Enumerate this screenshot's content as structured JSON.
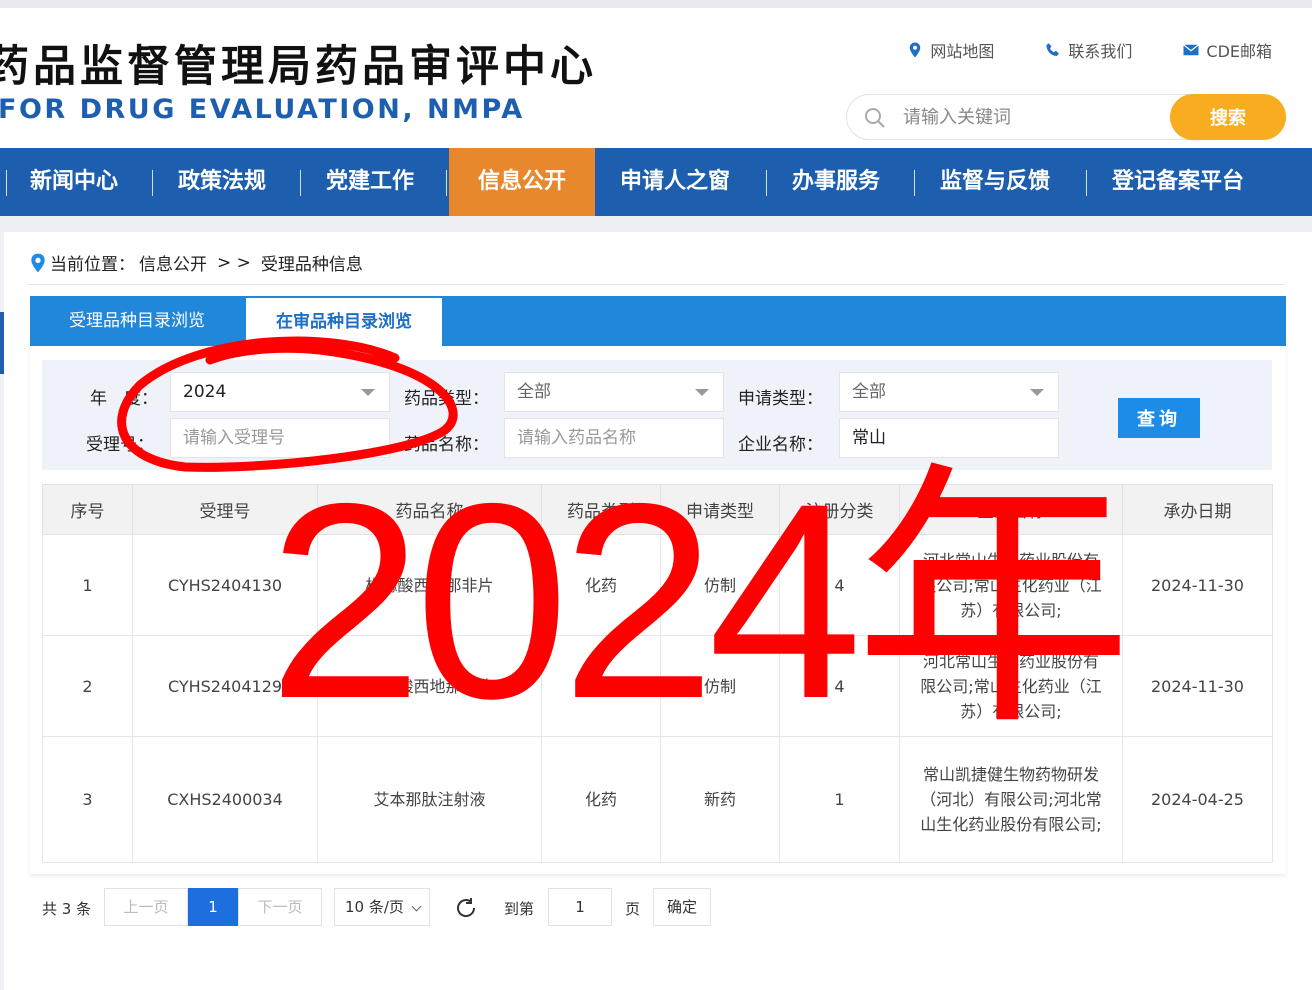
{
  "header": {
    "title_cn": "药品监督管理局药品审评中心",
    "title_en": "FOR DRUG EVALUATION, NMPA",
    "links": [
      {
        "label": "网站地图",
        "icon": "map-pin-icon"
      },
      {
        "label": "联系我们",
        "icon": "phone-icon"
      },
      {
        "label": "CDE邮箱",
        "icon": "mail-icon"
      }
    ],
    "search_placeholder": "请输入关键词",
    "search_button": "搜索"
  },
  "nav": {
    "items": [
      "新闻中心",
      "政策法规",
      "党建工作",
      "信息公开",
      "申请人之窗",
      "办事服务",
      "监督与反馈",
      "登记备案平台"
    ],
    "active": "信息公开"
  },
  "breadcrumb": {
    "prefix": "当前位置：",
    "section": "信息公开",
    "separator": "> >",
    "current": "受理品种信息"
  },
  "tabs": [
    "受理品种目录浏览",
    "在审品种目录浏览"
  ],
  "filters": {
    "year_label": "年　度：",
    "year_value": "2024",
    "drug_type_label": "药品类型：",
    "drug_type_value": "全部",
    "app_type_label": "申请类型：",
    "app_type_value": "全部",
    "accept_no_label": "受理号：",
    "accept_no_placeholder": "请输入受理号",
    "drug_name_label": "药品名称：",
    "drug_name_placeholder": "请输入药品名称",
    "company_label": "企业名称：",
    "company_value": "常山",
    "query_button": "查询"
  },
  "table": {
    "headers": [
      "序号",
      "受理号",
      "药品名称",
      "药品类型",
      "申请类型",
      "注册分类",
      "企业名称",
      "承办日期"
    ],
    "rows": [
      {
        "no": "1",
        "accept_no": "CYHS2404130",
        "drug_name": "枸橼酸西地那非片",
        "drug_type": "化药",
        "app_type": "仿制",
        "reg_class": "4",
        "company": "河北常山生化药业股份有限公司;常山生化药业（江苏）有限公司;",
        "date": "2024-11-30"
      },
      {
        "no": "2",
        "accept_no": "CYHS2404129",
        "drug_name": "枸橼酸西地那非片",
        "drug_type": "化药",
        "app_type": "仿制",
        "reg_class": "4",
        "company": "河北常山生化药业股份有限公司;常山生化药业（江苏）有限公司;",
        "date": "2024-11-30"
      },
      {
        "no": "3",
        "accept_no": "CXHS2400034",
        "drug_name": "艾本那肽注射液",
        "drug_type": "化药",
        "app_type": "新药",
        "reg_class": "1",
        "company": "常山凯捷健生物药物研发（河北）有限公司;河北常山生化药业股份有限公司;",
        "date": "2024-04-25"
      }
    ]
  },
  "pager": {
    "total": "共 3 条",
    "prev": "上一页",
    "current_page": "1",
    "next": "下一页",
    "page_size": "10 条/页",
    "goto_label": "到第",
    "goto_value": "1",
    "page_unit": "页",
    "confirm": "确定"
  },
  "annotation": {
    "text": "2024年",
    "color": "#ff0000"
  }
}
